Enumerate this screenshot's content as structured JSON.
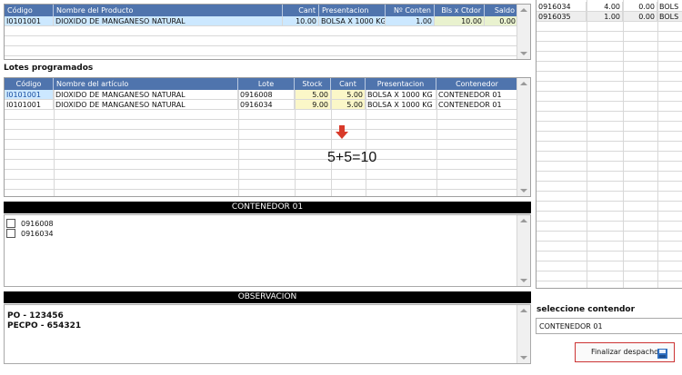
{
  "top_grid": {
    "headers": [
      "Código",
      "Nombre del Producto",
      "Cant",
      "Presentacion",
      "Nº Conten",
      "Bls x Ctdor",
      "Saldo"
    ],
    "rows": [
      [
        "I0101001",
        "DIOXIDO DE MANGANESO NATURAL",
        "10.00",
        "BOLSA X 1000 KG",
        "1.00",
        "10.00",
        "0.00"
      ]
    ]
  },
  "lotes": {
    "title": "Lotes programados",
    "headers": [
      "Código",
      "Nombre del artículo",
      "Lote",
      "Stock",
      "Cant",
      "Presentacion",
      "Contenedor"
    ],
    "rows": [
      [
        "I0101001",
        "DIOXIDO DE MANGANESO NATURAL",
        "0916008",
        "5.00",
        "5.00",
        "BOLSA X 1000 KG",
        "CONTENEDOR 01"
      ],
      [
        "I0101001",
        "DIOXIDO DE MANGANESO NATURAL",
        "0916034",
        "9.00",
        "5.00",
        "BOLSA X 1000 KG",
        "CONTENEDOR 01"
      ]
    ],
    "annotation": "5+5=10"
  },
  "contenedor": {
    "title": "CONTENEDOR 01",
    "items": [
      "0916008",
      "0916034"
    ]
  },
  "observacion": {
    "title": "OBSERVACION",
    "lines": [
      "PO - 123456",
      "PECPO - 654321"
    ]
  },
  "right_grid": {
    "rows": [
      [
        "0916034",
        "4.00",
        "0.00",
        "BOLS"
      ],
      [
        "0916035",
        "1.00",
        "0.00",
        "BOLS"
      ]
    ]
  },
  "seleccione": {
    "label": "seleccione contendor",
    "value": "CONTENEDOR 01"
  },
  "finalizar": {
    "label": "Finalizar despacho"
  },
  "colors": {
    "header_blue": "#4f74ad",
    "selected_row": "#cce8ff",
    "stock_yellow": "#fbf7c8",
    "green_cell": "#e9f2cf",
    "arrow_red": "#d83a2a"
  }
}
